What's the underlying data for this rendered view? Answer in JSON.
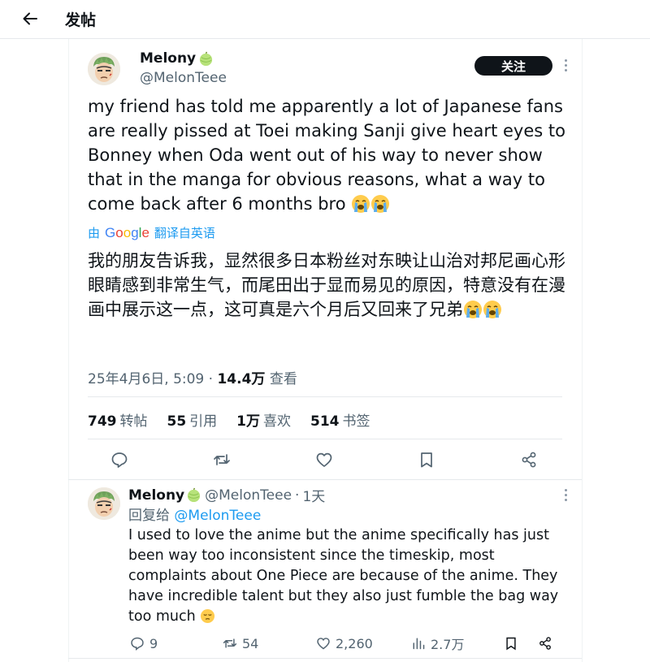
{
  "header": {
    "title": "发帖",
    "back_icon": "arrow-left-icon"
  },
  "tweet": {
    "author_name": "Melony",
    "author_emoji": "melon-emoji",
    "author_handle": "@MelonTeee",
    "follow_label": "关注",
    "text": "my friend has told me apparently a lot of Japanese fans are really pissed at Toei making Sanji give heart eyes to Bonney when Oda went out of his way to never show that in the manga for obvious reasons, what a way to come back after 6 months bro",
    "text_emoji": "loudly-crying-face-emoji",
    "translate_prefix": "由",
    "translate_brand": "Google",
    "translate_suffix": "翻译自英语",
    "translated_text": "我的朋友告诉我，显然很多日本粉丝对东映让山治对邦尼画心形眼睛感到非常生气，而尾田出于显而易见的原因，特意没有在漫画中展示这一点，这可真是六个月后又回来了兄弟",
    "timestamp": "25年4月6日, 5:09",
    "separator": "·",
    "views_count": "14.4万",
    "views_label": "查看",
    "stats": {
      "retweets_count": "749",
      "retweets_label": "转帖",
      "quotes_count": "55",
      "quotes_label": "引用",
      "likes_count": "1万",
      "likes_label": "喜欢",
      "bookmarks_count": "514",
      "bookmarks_label": "书签"
    }
  },
  "reply": {
    "author_name": "Melony",
    "author_handle": "@MelonTeee",
    "separator": "·",
    "time": "1天",
    "reply_to_label": "回复给",
    "reply_to_handle": "@MelonTeee",
    "text": "I used to love the anime but the anime specifically has just been way too inconsistent since the timeskip, most complaints about One Piece are because of the anime. They have incredible talent but they also just fumble the bag way too much",
    "text_emoji": "pensive-face-emoji",
    "replies": "9",
    "retweets": "54",
    "likes": "2,260",
    "views": "2.7万"
  },
  "colors": {
    "text": "#0f1419",
    "secondary": "#536471",
    "link": "#1d9bf0",
    "divider": "#e6e9ec",
    "follow_bg": "#0f1419"
  }
}
